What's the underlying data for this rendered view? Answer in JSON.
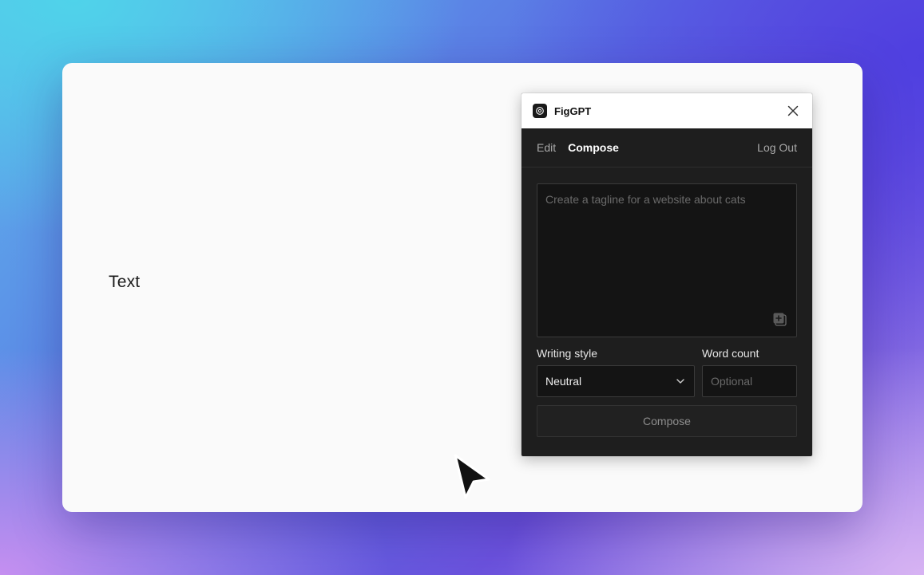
{
  "canvas": {
    "text_layer": "Text"
  },
  "plugin": {
    "title": "FigGPT",
    "logo_icon": "figgpt-logo-icon",
    "close_icon": "close-icon",
    "tabs": [
      {
        "label": "Edit",
        "active": false
      },
      {
        "label": "Compose",
        "active": true
      }
    ],
    "logout_label": "Log Out",
    "prompt": {
      "value": "",
      "placeholder": "Create a tagline for a website about cats"
    },
    "writing_style": {
      "label": "Writing style",
      "selected": "Neutral"
    },
    "word_count": {
      "label": "Word count",
      "value": "",
      "placeholder": "Optional"
    },
    "compose_button_label": "Compose"
  },
  "colors": {
    "panel_bg": "#1e1e1e",
    "input_bg": "#141414",
    "titlebar_bg": "#ffffff",
    "canvas_bg": "#fafafa"
  }
}
